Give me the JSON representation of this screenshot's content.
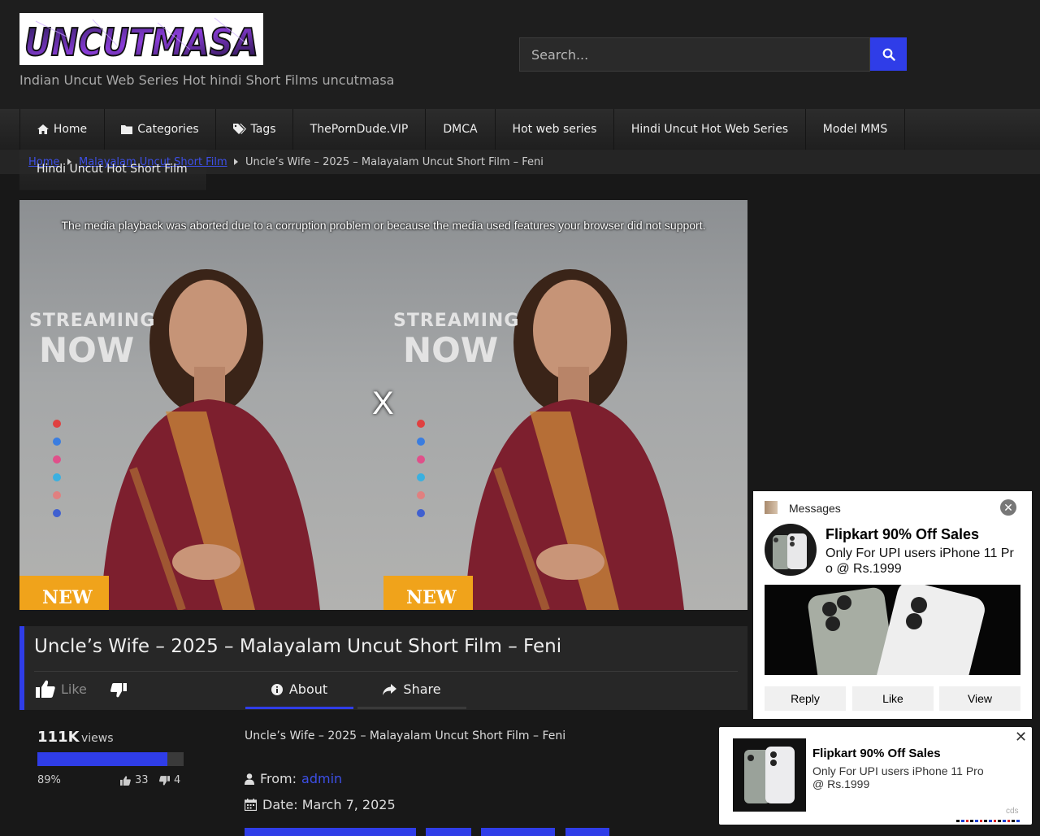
{
  "site": {
    "logo_text": "UNCUTMASA",
    "tagline": "Indian Uncut Web Series Hot hindi Short Films uncutmasa"
  },
  "search": {
    "placeholder": "Search..."
  },
  "nav": {
    "items": [
      {
        "label": "Home",
        "icon": "home-icon"
      },
      {
        "label": "Categories",
        "icon": "folder-icon"
      },
      {
        "label": "Tags",
        "icon": "tags-icon"
      },
      {
        "label": "ThePornDude.VIP"
      },
      {
        "label": "DMCA"
      },
      {
        "label": "Hot web series"
      },
      {
        "label": "Hindi Uncut Hot Web Series"
      },
      {
        "label": "Model MMS"
      }
    ],
    "sub_item": "Hindi Uncut Hot Short Film"
  },
  "breadcrumb": {
    "home": "Home",
    "category": "Malayalam Uncut Short Film",
    "current": "Uncle’s Wife – 2025 – Malayalam Uncut Short Film – Feni"
  },
  "player": {
    "error_message": "The media playback was aborted due to a corruption problem or because the media used features your browser did not support.",
    "close_label": "X",
    "frame_text_1": "STREAMING",
    "frame_text_2": "NOW",
    "badge": "NEW"
  },
  "video": {
    "title": "Uncle’s Wife – 2025 – Malayalam Uncut Short Film – Feni",
    "like_label": "Like",
    "tabs": {
      "about": "About",
      "share": "Share"
    },
    "views_count": "111K",
    "views_label": "views",
    "rating_percent": 89,
    "rating_text": "89%",
    "likes": "33",
    "dislikes": "4",
    "description": "Uncle’s Wife – 2025 – Malayalam Uncut Short Film – Feni",
    "from_label": "From:",
    "author": "admin",
    "date_text": "Date: March 7, 2025"
  },
  "message_popup": {
    "app_label": "Messages",
    "title": "Flipkart 90% Off Sales",
    "text": "Only For UPI users iPhone 11 Pro @ Rs.1999",
    "buttons": {
      "reply": "Reply",
      "like": "Like",
      "view": "View"
    }
  },
  "ad_card": {
    "title": "Flipkart 90% Off Sales",
    "text": "Only For UPI users iPhone 11 Pro @ Rs.1999",
    "tag": "cds",
    "close": "✕"
  },
  "colors": {
    "accent": "#2f3de8",
    "background": "#181818",
    "link": "#3d4fe6"
  }
}
